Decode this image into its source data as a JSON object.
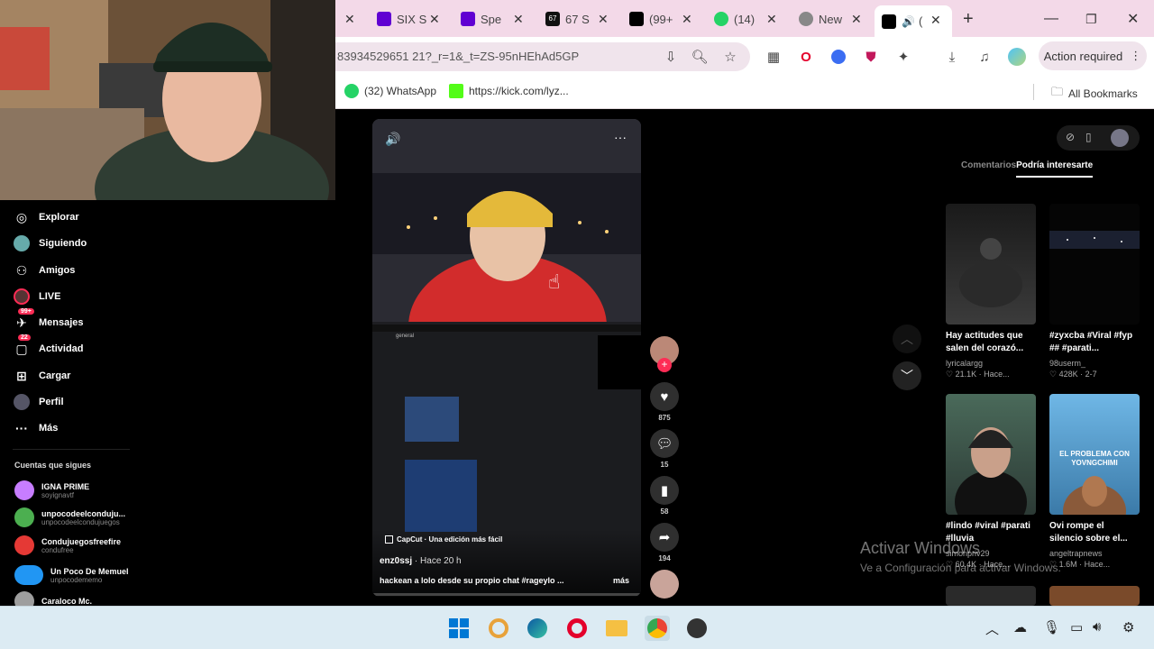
{
  "browser": {
    "tabs": [
      {
        "label": "SIX S",
        "icon": "yahoo-icon"
      },
      {
        "label": "Spe",
        "icon": "yahoo-icon"
      },
      {
        "label": "67 S",
        "icon": "sixtyseven-icon"
      },
      {
        "label": "(99+",
        "icon": "tiktok-icon"
      },
      {
        "label": "(14)",
        "icon": "whatsapp-icon"
      },
      {
        "label": "New",
        "icon": "globe-icon"
      },
      {
        "label": "(",
        "icon": "tiktok-icon"
      }
    ],
    "url": "83934529651 21?_r=1&_t=ZS-95nHEhAd5GP",
    "action_required": "Action required",
    "bookmarks": {
      "whatsapp": "(32) WhatsApp",
      "kick": "https://kick.com/lyz...",
      "all": "All Bookmarks"
    }
  },
  "sidebar": {
    "nav": [
      {
        "label": "Explorar",
        "icon": "compass-icon"
      },
      {
        "label": "Siguiendo",
        "icon": "following-icon"
      },
      {
        "label": "Amigos",
        "icon": "friends-icon"
      },
      {
        "label": "LIVE",
        "icon": "live-icon"
      },
      {
        "label": "Mensajes",
        "icon": "messages-icon",
        "badge": "99+"
      },
      {
        "label": "Actividad",
        "icon": "activity-icon",
        "badge": "22"
      },
      {
        "label": "Cargar",
        "icon": "upload-icon"
      },
      {
        "label": "Perfil",
        "icon": "profile-icon"
      },
      {
        "label": "Más",
        "icon": "more-icon"
      }
    ],
    "following_title": "Cuentas que sigues",
    "accounts": [
      {
        "name": "IGNA PRIME",
        "handle": "soyignavtf"
      },
      {
        "name": "unpocodeelconduju...",
        "handle": "unpocodeelcondujuegos"
      },
      {
        "name": "Condujuegosfreefire",
        "handle": "condufree"
      },
      {
        "name": "Un Poco De Memuel",
        "handle": "unpocodememo"
      },
      {
        "name": "Caraloco Mc.",
        "handle": ""
      }
    ]
  },
  "video": {
    "capcut": "CapCut · Una edición más fácil",
    "author": "enz0ssj",
    "time": "· Hace 20 h",
    "caption": "hackean a lolo desde su propio chat  #rageylo ...",
    "more": "más",
    "discord_channel": "general"
  },
  "actions": {
    "likes": "875",
    "comments": "15",
    "saves": "58",
    "shares": "194"
  },
  "right_panel": {
    "tab_comments": "Comentarios",
    "tab_interest": "Podría interesarte",
    "videos": [
      {
        "title": "Hay actitudes que salen del corazó...",
        "author": "lyricalargg",
        "stats": "♡ 21.1K · Hace..."
      },
      {
        "title": "#zyxcba #Viral #fyp ## #parati...",
        "author": "98userm_",
        "stats": "♡ 428K · 2-7"
      },
      {
        "title": "#lindo #viral #parati #lluvia",
        "author": "simonpriv29",
        "stats": "♡ 60.4K · Hace..."
      },
      {
        "title": "Ovi rompe el silencio sobre el...",
        "author": "angeltrapnews",
        "stats": "♡ 1.6M · Hace..."
      }
    ],
    "thumb2_text": "EL PROBLEMA CON YOVNGCHIMI"
  },
  "watermark": {
    "line1": "Activar Windows",
    "line2": "Ve a Configuración para activar Windows."
  },
  "colors": {
    "tiktok_red": "#fe2c55",
    "tab_bg": "#f3d9e8",
    "taskbar": "#dcebf3"
  }
}
